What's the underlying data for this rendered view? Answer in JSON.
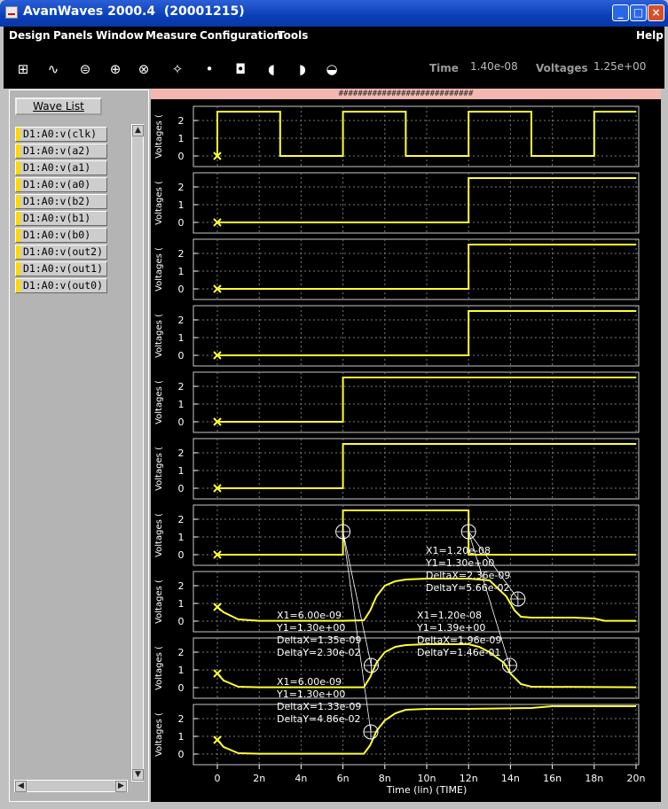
{
  "window": {
    "title": "AvanWaves 2000.4  (20001215)",
    "buttons": {
      "minimize": "_",
      "maximize": "□",
      "close": "×"
    }
  },
  "menu": {
    "items": [
      "Design",
      "Panels",
      "Window",
      "Measure",
      "Configuration",
      "Tools"
    ],
    "help": "Help"
  },
  "toolbar": {
    "icons": [
      "panel-tree-icon",
      "waveform-ops-icon",
      "measure-icon",
      "cursor-add-icon",
      "crosshair-icon",
      "zoom-icon",
      "zoom-fit-icon",
      "zoom-in-icon",
      "zoom-out-icon",
      "zoom-y-icon",
      "zoom-x-icon"
    ],
    "time_label": "Time",
    "time_value": "1.40e-08",
    "voltages_label": "Voltages",
    "voltages_value": "1.25e+00"
  },
  "wave_list": {
    "button_label": "Wave List",
    "items": [
      "D1:A0:v(clk)",
      "D1:A0:v(a2)",
      "D1:A0:v(a1)",
      "D1:A0:v(a0)",
      "D1:A0:v(b2)",
      "D1:A0:v(b1)",
      "D1:A0:v(b0)",
      "D1:A0:v(out2)",
      "D1:A0:v(out1)",
      "D1:A0:v(out0)"
    ],
    "swatch_color": "#ffd800"
  },
  "plot": {
    "header": "############################",
    "trace_color": "#ffff33",
    "background": "#000000",
    "panel_ylabel": "Voltages (",
    "y_ticks": [
      "0",
      "1",
      "2"
    ],
    "xlabel": "Time (lin) (TIME)",
    "x_ticks": [
      "0",
      "2n",
      "4n",
      "6n",
      "8n",
      "10n",
      "12n",
      "14n",
      "16n",
      "18n",
      "20n"
    ],
    "annotations": [
      [
        "X1=1.20e-08",
        "Y1=1.30e+00",
        "DeltaX=2.36e-09",
        "DeltaY=5.66e-02"
      ],
      [
        "X1=6.00e-09",
        "Y1=1.30e+00",
        "DeltaX=1.35e-09",
        "DeltaY=2.30e-02"
      ],
      [
        "X1=1.20e-08",
        "Y1=1.39e+00",
        "DeltaX=1.96e-09",
        "DeltaY=1.46e-01"
      ],
      [
        "X1=6.00e-09",
        "Y1=1.30e+00",
        "DeltaX=1.33e-09",
        "DeltaY=4.86e-02"
      ]
    ]
  },
  "chart_data": {
    "type": "line",
    "xlabel": "Time (lin) (TIME)",
    "ylabel": "Voltages (",
    "x_unit": "ns",
    "xlim": [
      0,
      20
    ],
    "ylim": [
      0,
      2.5
    ],
    "series": [
      {
        "name": "D1:A0:v(clk)",
        "x": [
          0,
          0,
          3,
          3,
          6,
          6,
          9,
          9,
          12,
          12,
          15,
          15,
          18,
          18,
          20
        ],
        "y": [
          0,
          2.5,
          2.5,
          0,
          0,
          2.5,
          2.5,
          0,
          0,
          2.5,
          2.5,
          0,
          0,
          2.5,
          2.5
        ]
      },
      {
        "name": "D1:A0:v(a2)",
        "x": [
          0,
          12,
          12,
          20
        ],
        "y": [
          0,
          0,
          2.5,
          2.5
        ]
      },
      {
        "name": "D1:A0:v(a1)",
        "x": [
          0,
          12,
          12,
          20
        ],
        "y": [
          0,
          0,
          2.5,
          2.5
        ]
      },
      {
        "name": "D1:A0:v(a0)",
        "x": [
          0,
          12,
          12,
          20
        ],
        "y": [
          0,
          0,
          2.5,
          2.5
        ]
      },
      {
        "name": "D1:A0:v(b2)",
        "x": [
          0,
          6,
          6,
          20
        ],
        "y": [
          0,
          0,
          2.5,
          2.5
        ]
      },
      {
        "name": "D1:A0:v(b1)",
        "x": [
          0,
          6,
          6,
          20
        ],
        "y": [
          0,
          0,
          2.5,
          2.5
        ]
      },
      {
        "name": "D1:A0:v(b0)",
        "x": [
          0,
          6,
          6,
          12,
          12,
          20
        ],
        "y": [
          0,
          0,
          2.5,
          2.5,
          0,
          0
        ]
      },
      {
        "name": "D1:A0:v(out2)",
        "x": [
          0,
          0.3,
          1,
          2,
          6,
          7,
          7.3,
          7.6,
          8,
          8.5,
          9,
          10,
          12,
          13,
          13.8,
          14.2,
          14.5,
          15,
          17,
          18,
          18.5,
          20
        ],
        "y": [
          0.8,
          0.5,
          0.1,
          0.02,
          0.02,
          0.05,
          0.6,
          1.4,
          2.0,
          2.25,
          2.35,
          2.4,
          2.4,
          2.3,
          1.4,
          0.6,
          0.25,
          0.2,
          0.2,
          0.15,
          0.02,
          0.02
        ]
      },
      {
        "name": "D1:A0:v(out1)",
        "x": [
          0,
          0.3,
          1,
          2,
          7,
          7.3,
          7.6,
          8,
          8.5,
          9,
          10,
          12,
          12.5,
          13,
          13.7,
          14,
          14.5,
          15,
          20
        ],
        "y": [
          0.8,
          0.4,
          0.05,
          0.02,
          0.02,
          0.6,
          1.4,
          2.0,
          2.3,
          2.4,
          2.45,
          2.45,
          2.3,
          2.0,
          1.39,
          0.8,
          0.2,
          0.05,
          0.02
        ]
      },
      {
        "name": "D1:A0:v(out0)",
        "x": [
          0,
          0.3,
          1,
          2,
          7,
          7.3,
          7.6,
          8,
          8.5,
          9,
          10,
          12,
          15,
          15.5,
          16,
          17,
          20
        ],
        "y": [
          0.8,
          0.4,
          0.05,
          0.02,
          0.02,
          0.5,
          1.3,
          1.9,
          2.3,
          2.5,
          2.55,
          2.55,
          2.6,
          2.65,
          2.7,
          2.7,
          2.7
        ]
      }
    ]
  }
}
